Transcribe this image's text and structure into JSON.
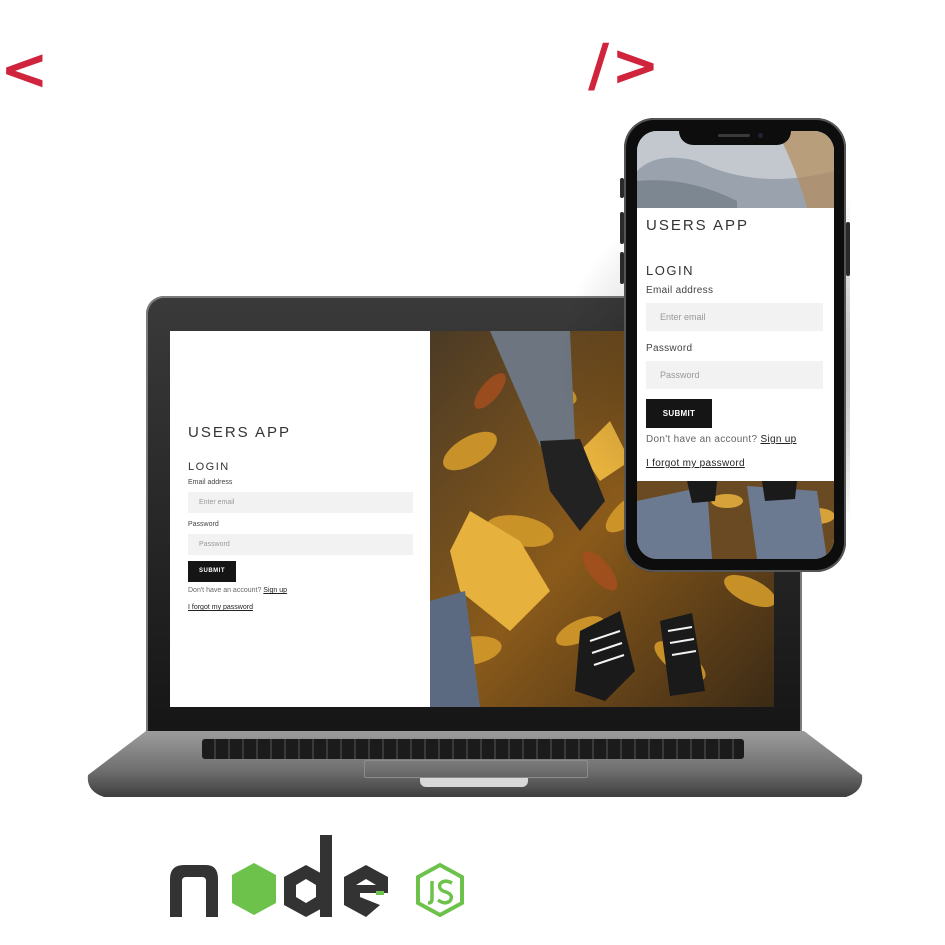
{
  "decor": {
    "code_open": "<",
    "code_close": "/>",
    "code_color": "#d0243c"
  },
  "laptop_app": {
    "title": "USERS APP",
    "heading": "LOGIN",
    "email_label": "Email address",
    "email_placeholder": "Enter email",
    "password_label": "Password",
    "password_placeholder": "Password",
    "submit_label": "SUBMIT",
    "signup_prompt": "Don't have an account?",
    "signup_link": "Sign up",
    "forgot_link": "I forgot my password"
  },
  "phone_app": {
    "title": "USERS APP",
    "heading": "LOGIN",
    "email_label": "Email address",
    "email_placeholder": "Enter email",
    "password_label": "Password",
    "password_placeholder": "Password",
    "submit_label": "SUBMIT",
    "signup_prompt": "Don't have an account?",
    "signup_link": "Sign up",
    "forgot_link": "I forgot my password"
  },
  "logo": {
    "name": "node-js-logo",
    "dark_color": "#333333",
    "green_color": "#6cc24a"
  },
  "icons": [
    "autumn-leaves-photo",
    "sneakers-photo",
    "node-js-logo"
  ]
}
